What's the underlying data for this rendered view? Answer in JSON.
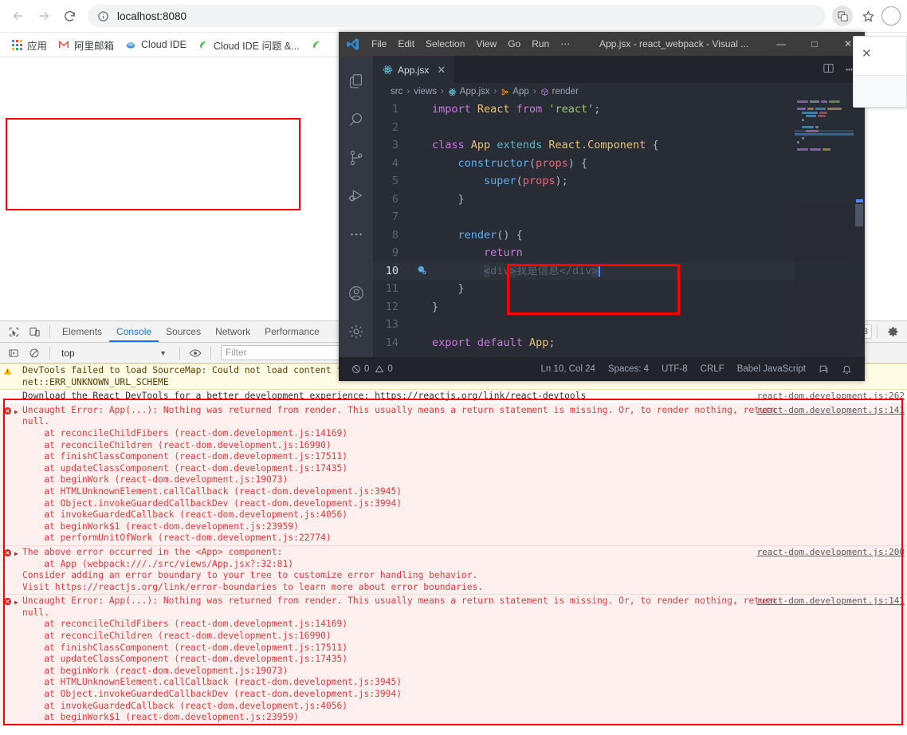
{
  "browser": {
    "back_label": "back",
    "forward_label": "forward",
    "reload_label": "reload",
    "url": "localhost:8080",
    "bookmarks": [
      {
        "label": "应用",
        "icon": "apps-grid-icon"
      },
      {
        "label": "阿里邮箱",
        "icon": "mail-m-icon"
      },
      {
        "label": "Cloud IDE",
        "icon": "cloud-ide-icon"
      },
      {
        "label": "Cloud IDE 问题 &...",
        "icon": "leaf-icon"
      }
    ]
  },
  "popup": {
    "close_label": "✕"
  },
  "vscode": {
    "menu": [
      "File",
      "Edit",
      "Selection",
      "View",
      "Go",
      "Run",
      "⋯"
    ],
    "title": "App.jsx - react_webpack - Visual ...",
    "window_controls": {
      "minimize": "—",
      "maximize": "□",
      "close": "✕"
    },
    "tab": {
      "label": "App.jsx",
      "close": "✕"
    },
    "tab_actions": {
      "split_editor": "split-editor-icon",
      "more": "⋯"
    },
    "breadcrumb": [
      "src",
      "views",
      "App.jsx",
      "App",
      "render"
    ],
    "activity_bar": [
      "explorer-icon",
      "search-icon",
      "source-control-icon",
      "run-and-debug-icon",
      "more-views-icon",
      "account-icon",
      "settings-gear-icon"
    ],
    "code_lines": [
      {
        "n": "1",
        "text": "import React from 'react';"
      },
      {
        "n": "2",
        "text": ""
      },
      {
        "n": "3",
        "text": "class App extends React.Component {"
      },
      {
        "n": "4",
        "text": "    constructor(props) {"
      },
      {
        "n": "5",
        "text": "        super(props);"
      },
      {
        "n": "6",
        "text": "    }"
      },
      {
        "n": "7",
        "text": ""
      },
      {
        "n": "8",
        "text": "    render() {"
      },
      {
        "n": "9",
        "text": "        return"
      },
      {
        "n": "10",
        "text": "        <div>我是信息</div>"
      },
      {
        "n": "11",
        "text": "    }"
      },
      {
        "n": "12",
        "text": "}"
      },
      {
        "n": "13",
        "text": ""
      },
      {
        "n": "14",
        "text": "export default App;"
      }
    ],
    "status_bar": {
      "errors": "0",
      "warnings": "0",
      "cursor": "Ln 10, Col 24",
      "spaces": "Spaces: 4",
      "encoding": "UTF-8",
      "eol": "CRLF",
      "language": "Babel JavaScript",
      "feedback_icon": "feedback-icon",
      "bell_icon": "bell-icon"
    }
  },
  "devtools": {
    "tabs": [
      "Elements",
      "Console",
      "Sources",
      "Network",
      "Performance"
    ],
    "active_tab": "Console",
    "inspect_icon": "inspect-element-icon",
    "device_icon": "toggle-device-toolbar-icon",
    "error_count": "3",
    "settings_icon": "settings-gear-icon",
    "filter_bar": {
      "execute_icon": "execute-top-icon",
      "clear_icon": "clear-console-icon",
      "context": "top",
      "eye_icon": "live-expression-icon",
      "filter_placeholder": "Filter"
    },
    "messages": [
      {
        "type": "warn",
        "lines": [
          "DevTools failed to load SourceMap: Could not load content for",
          "net::ERR_UNKNOWN_URL_SCHEME"
        ],
        "source": ""
      },
      {
        "type": "info",
        "lines": [
          "Download the React DevTools for a better development experience: https://reactjs.org/link/react-devtools"
        ],
        "source": "react-dom.development.js:262"
      },
      {
        "type": "error",
        "lines": [
          "Uncaught Error: App(...): Nothing was returned from render. This usually means a return statement is missing. Or, to render nothing, return",
          "null.",
          "    at reconcileChildFibers (react-dom.development.js:14169)",
          "    at reconcileChildren (react-dom.development.js:16990)",
          "    at finishClassComponent (react-dom.development.js:17511)",
          "    at updateClassComponent (react-dom.development.js:17435)",
          "    at beginWork (react-dom.development.js:19073)",
          "    at HTMLUnknownElement.callCallback (react-dom.development.js:3945)",
          "    at Object.invokeGuardedCallbackDev (react-dom.development.js:3994)",
          "    at invokeGuardedCallback (react-dom.development.js:4056)",
          "    at beginWork$1 (react-dom.development.js:23959)",
          "    at performUnitOfWork (react-dom.development.js:22774)"
        ],
        "source": "react-dom.development.js:141"
      },
      {
        "type": "error",
        "lines": [
          "The above error occurred in the <App> component:",
          "",
          "    at App (webpack:///./src/views/App.jsx?:32:81)",
          "",
          "Consider adding an error boundary to your tree to customize error handling behavior.",
          "Visit https://reactjs.org/link/error-boundaries to learn more about error boundaries."
        ],
        "source": "react-dom.development.js:200"
      },
      {
        "type": "error",
        "lines": [
          "Uncaught Error: App(...): Nothing was returned from render. This usually means a return statement is missing. Or, to render nothing, return",
          "null.",
          "    at reconcileChildFibers (react-dom.development.js:14169)",
          "    at reconcileChildren (react-dom.development.js:16990)",
          "    at finishClassComponent (react-dom.development.js:17511)",
          "    at updateClassComponent (react-dom.development.js:17435)",
          "    at beginWork (react-dom.development.js:19073)",
          "    at HTMLUnknownElement.callCallback (react-dom.development.js:3945)",
          "    at Object.invokeGuardedCallbackDev (react-dom.development.js:3994)",
          "    at invokeGuardedCallback (react-dom.development.js:4056)",
          "    at beginWork$1 (react-dom.development.js:23959)"
        ],
        "source": "react-dom.development.js:141"
      }
    ]
  },
  "annotations": {
    "page_box_color": "#ff0000",
    "code_box_color": "#ff0000",
    "console_box_color": "#ff0000"
  }
}
